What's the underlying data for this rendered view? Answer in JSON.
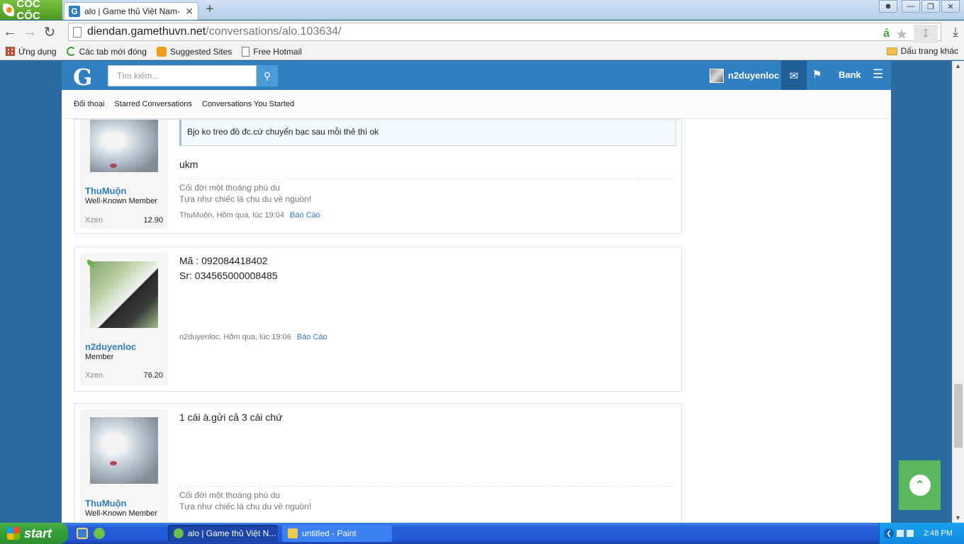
{
  "browser": {
    "brand": "CỐC CỐC",
    "tab_title": "alo | Game thủ Việt Nam- MU",
    "tab_close": "✕",
    "new_tab": "+",
    "url_host": "diendan.gamethuvn.net",
    "url_path": "/conversations/alo.103634/",
    "bookmarks": [
      {
        "label": "Ứng dụng",
        "icon": "apps-icon"
      },
      {
        "label": "Các tab mới đóng",
        "icon": "recent-tabs-icon"
      },
      {
        "label": "Suggested Sites",
        "icon": "suggested-sites-icon"
      },
      {
        "label": "Free Hotmail",
        "icon": "page-icon"
      }
    ],
    "other_bookmarks": "Dấu trang khác"
  },
  "site": {
    "logo": "G",
    "search_placeholder": "Tìm kiếm...",
    "username": "n2duyenloc",
    "bank_label": "Bank",
    "subnav": [
      "Đối thoại",
      "Starred Conversations",
      "Conversations You Started"
    ]
  },
  "messages": [
    {
      "author": "ThuMuộn",
      "user_title": "Well-Known Member",
      "stat_label": "Xzen",
      "stat_value": "12.90",
      "quote": "Bjo ko treo đồ đc.cứ chuyển bạc sau mỗi thẻ thì ok",
      "text": [
        "ukm"
      ],
      "signature": [
        "Cối đời một thoáng phù du",
        "Tựa như chiếc lá chu du về nguồn!"
      ],
      "meta": "ThuMuộn, Hôm qua, lúc 19:04",
      "report": "Báo Cáo"
    },
    {
      "author": "n2duyenloc",
      "user_title": "Member",
      "stat_label": "Xzen",
      "stat_value": "76.20",
      "text": [
        "Mã : 092084418402",
        "Sr: 034565000008485"
      ],
      "meta": "n2duyenloc, Hôm qua, lúc 19:06",
      "report": "Báo Cáo"
    },
    {
      "author": "ThuMuộn",
      "user_title": "Well-Known Member",
      "text": [
        "1 cái à.gửi cả 3 cái chứ"
      ],
      "signature": [
        "Cối đời một thoáng phù du",
        "Tựa như chiếc lá chu du về nguồn!"
      ]
    }
  ],
  "taskbar": {
    "start": "start",
    "tasks": [
      "alo | Game thủ Việt N...",
      "untitled - Paint"
    ],
    "clock": "2:48 PM"
  },
  "colors": {
    "site_header": "#2f7fc1",
    "link": "#2f7fc1",
    "back_to_top": "#5cb85c"
  }
}
